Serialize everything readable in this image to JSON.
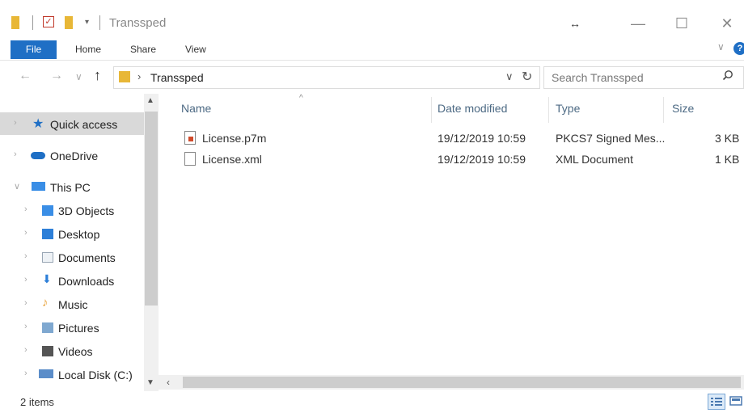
{
  "window": {
    "title": "Transsped",
    "minimize_glyph": "—",
    "maximize_glyph": "☐",
    "close_glyph": "✕",
    "resize_glyph": "↔"
  },
  "ribbon": {
    "file": "File",
    "tabs": [
      "Home",
      "Share",
      "View"
    ],
    "chevron": "∨",
    "help": "?"
  },
  "address": {
    "separator": "›",
    "path": "Transsped",
    "dropdown": "∨",
    "refresh": "↻"
  },
  "search": {
    "placeholder": "Search Transsped",
    "icon": "search-icon"
  },
  "nav_buttons": {
    "back": "←",
    "forward": "→",
    "recent": "∨",
    "up": "↑"
  },
  "nav_pane": {
    "items": [
      {
        "label": "Quick access",
        "icon": "star-icon",
        "color": "#1f6fc5"
      },
      {
        "label": "OneDrive",
        "icon": "cloud-icon",
        "color": "#1f6fc5"
      },
      {
        "label": "This PC",
        "icon": "computer-icon",
        "color": "#3a8ee6"
      },
      {
        "label": "3D Objects",
        "icon": "3d-objects-icon",
        "color": "#3a8ee6"
      },
      {
        "label": "Desktop",
        "icon": "desktop-icon",
        "color": "#2d7fd8"
      },
      {
        "label": "Documents",
        "icon": "documents-icon",
        "color": "#9aa7b5"
      },
      {
        "label": "Downloads",
        "icon": "downloads-icon",
        "color": "#2d7fd8"
      },
      {
        "label": "Music",
        "icon": "music-icon",
        "color": "#e8a23a"
      },
      {
        "label": "Pictures",
        "icon": "pictures-icon",
        "color": "#7fa8d0"
      },
      {
        "label": "Videos",
        "icon": "videos-icon",
        "color": "#555555"
      },
      {
        "label": "Local Disk (C:)",
        "icon": "disk-icon",
        "color": "#5b8dc9"
      }
    ],
    "chevron_right": "›",
    "chevron_down": "∨"
  },
  "columns": {
    "name": "Name",
    "date": "Date modified",
    "type": "Type",
    "size": "Size"
  },
  "files": [
    {
      "name": "License.p7m",
      "date": "19/12/2019 10:59",
      "type": "PKCS7 Signed Mes...",
      "size": "3 KB",
      "icon": "certificate-file-icon"
    },
    {
      "name": "License.xml",
      "date": "19/12/2019 10:59",
      "type": "XML Document",
      "size": "1 KB",
      "icon": "xml-file-icon"
    }
  ],
  "status": {
    "items": "2 items"
  },
  "colors": {
    "accent": "#1f6fc5",
    "folder": "#e8b737"
  }
}
